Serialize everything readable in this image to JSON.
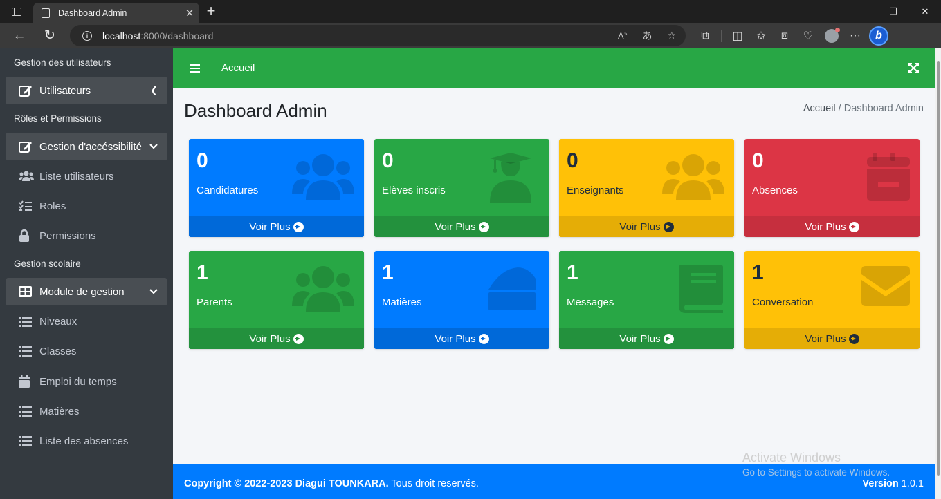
{
  "browser": {
    "tab_title": "Dashboard Admin",
    "url_host": "localhost",
    "url_path": ":8000/dashboard"
  },
  "sidebar": {
    "headers": [
      "Gestion des utilisateurs",
      "Rôles et Permissions",
      "Gestion scolaire"
    ],
    "items": [
      {
        "label": "Utilisateurs",
        "icon": "edit-icon",
        "active": true,
        "chevron": "left"
      },
      {
        "label": "Gestion d'accéssibilité",
        "icon": "edit-icon",
        "active": true,
        "chevron": "down"
      },
      {
        "label": "Liste utilisateurs",
        "icon": "users-icon"
      },
      {
        "label": "Roles",
        "icon": "tasks-icon"
      },
      {
        "label": "Permissions",
        "icon": "lock-icon"
      },
      {
        "label": "Module de gestion",
        "icon": "table-icon",
        "active": true,
        "chevron": "down"
      },
      {
        "label": "Niveaux",
        "icon": "list-icon"
      },
      {
        "label": "Classes",
        "icon": "list-icon"
      },
      {
        "label": "Emploi du temps",
        "icon": "calendar-icon"
      },
      {
        "label": "Matières",
        "icon": "list-icon"
      },
      {
        "label": "Liste des absences",
        "icon": "list-icon"
      }
    ]
  },
  "topnav": {
    "home_label": "Accueil"
  },
  "page": {
    "title": "Dashboard Admin",
    "breadcrumb_home": "Accueil",
    "breadcrumb_sep": "/",
    "breadcrumb_current": "Dashboard Admin"
  },
  "boxes": [
    {
      "count": "0",
      "label": "Candidatures",
      "link": "Voir Plus",
      "color": "#007bff",
      "icon": "users-icon"
    },
    {
      "count": "0",
      "label": "Elèves inscris",
      "link": "Voir Plus",
      "color": "#28a745",
      "icon": "graduate-icon"
    },
    {
      "count": "0",
      "label": "Enseignants",
      "link": "Voir Plus",
      "color": "#ffc107",
      "icon": "users-icon"
    },
    {
      "count": "0",
      "label": "Absences",
      "link": "Voir Plus",
      "color": "#dc3545",
      "icon": "calendar-minus-icon"
    },
    {
      "count": "1",
      "label": "Parents",
      "link": "Voir Plus",
      "color": "#28a745",
      "icon": "users-icon"
    },
    {
      "count": "1",
      "label": "Matières",
      "link": "Voir Plus",
      "color": "#007bff",
      "icon": "cheese-icon"
    },
    {
      "count": "1",
      "label": "Messages",
      "link": "Voir Plus",
      "color": "#28a745",
      "icon": "book-icon"
    },
    {
      "count": "1",
      "label": "Conversation",
      "link": "Voir Plus",
      "color": "#ffc107",
      "icon": "envelope-icon"
    }
  ],
  "footer": {
    "copyright_bold": "Copyright © 2022-2023 Diagui TOUNKARA.",
    "copyright_rest": " Tous droit reservés.",
    "version_label": "Version",
    "version_value": " 1.0.1"
  },
  "watermark": {
    "line1": "Activate Windows",
    "line2": "Go to Settings to activate Windows."
  }
}
